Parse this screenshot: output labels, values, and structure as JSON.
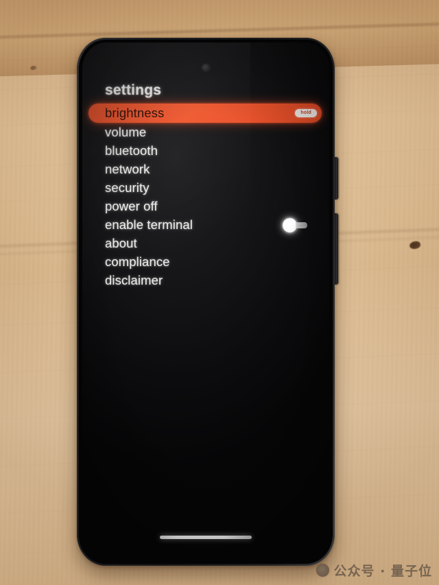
{
  "device": {
    "name": "smartphone",
    "front_camera": "front-camera",
    "side_buttons": [
      "power",
      "volume"
    ],
    "home_indicator": "home-indicator"
  },
  "screen": {
    "title": "settings",
    "menu": [
      {
        "label": "brightness",
        "selected": true,
        "badge": "hold"
      },
      {
        "label": "volume",
        "selected": false
      },
      {
        "label": "bluetooth",
        "selected": false
      },
      {
        "label": "network",
        "selected": false
      },
      {
        "label": "security",
        "selected": false
      },
      {
        "label": "power off",
        "selected": false
      },
      {
        "label": "enable terminal",
        "selected": false
      },
      {
        "label": "about",
        "selected": false
      },
      {
        "label": "compliance",
        "selected": false
      },
      {
        "label": "disclaimer",
        "selected": false
      }
    ],
    "side_indicator": "scroll-handle"
  },
  "watermark": {
    "logo": "wechat-account-logo",
    "text": "公众号 · 量子位"
  },
  "colors": {
    "accent": "#E9512B",
    "screen_background": "#0C0C0E",
    "text": "#EFEDEB",
    "badge_background": "#F7F1EE",
    "wood": "#DCBB92"
  }
}
